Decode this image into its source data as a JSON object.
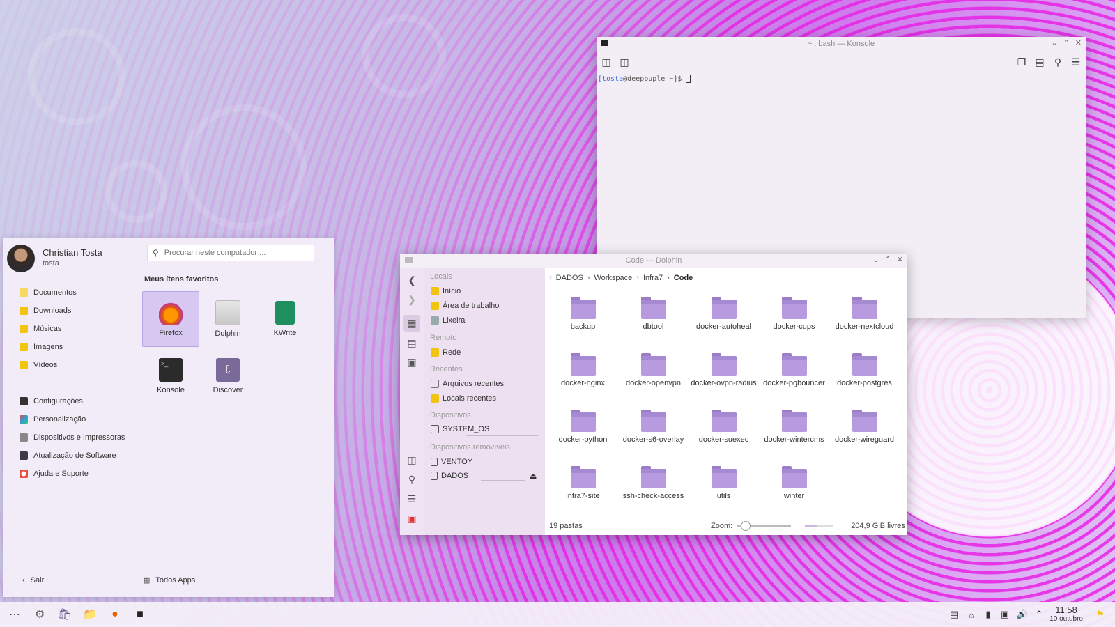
{
  "colors": {
    "accent": "#b89ae0",
    "folder": "#b89ae0",
    "selection": "#d6c8f0",
    "ribbon": "#e628e6"
  },
  "konsole": {
    "title": "~ : bash — Konsole",
    "prompt_user": "[tosta",
    "prompt_host": "@deeppuple ~]$",
    "toolbar_icons": [
      "new-tab-icon",
      "split-view-icon",
      "copy-icon",
      "paste-icon",
      "search-icon",
      "menu-icon"
    ]
  },
  "dolphin": {
    "title": "Code — Dolphin",
    "places": {
      "locais_head": "Locais",
      "inicio": "Início",
      "area": "Área de trabalho",
      "lixeira": "Lixeira",
      "remoto_head": "Remoto",
      "rede": "Rede",
      "recentes_head": "Recentes",
      "arquivos_recentes": "Arquivos recentes",
      "locais_recentes": "Locais recentes",
      "dispositivos_head": "Dispositivos",
      "system_os": "SYSTEM_OS",
      "removiveis_head": "Dispositivos removíveis",
      "ventoy": "VENTOY",
      "dados": "DADOS"
    },
    "breadcrumb": {
      "a": "DADOS",
      "b": "Workspace",
      "c": "Infra7",
      "current": "Code"
    },
    "folders": [
      "backup",
      "dbtool",
      "docker-autoheal",
      "docker-cups",
      "docker-nextcloud",
      "docker-nginx",
      "docker-openvpn",
      "docker-ovpn-radius",
      "docker-pgbouncer",
      "docker-postgres",
      "docker-python",
      "docker-s6-overlay",
      "docker-suexec",
      "docker-wintercms",
      "docker-wireguard",
      "infra7-site",
      "ssh-check-access",
      "utils",
      "winter"
    ],
    "status": {
      "count": "19 pastas",
      "zoom_label": "Zoom:",
      "free": "204,9 GiB livres",
      "zoom_fraction": 0.15
    }
  },
  "launcher": {
    "user_name": "Christian Tosta",
    "user_login": "tosta",
    "search_placeholder": "Procurar neste computador ...",
    "places": {
      "documentos": "Documentos",
      "downloads": "Downloads",
      "musicas": "Músicas",
      "imagens": "Imagens",
      "videos": "Vídeos"
    },
    "system": {
      "config": "Configurações",
      "personal": "Personalização",
      "devices": "Dispositivos e Impressoras",
      "update": "Atualização de Software",
      "help": "Ajuda e Suporte"
    },
    "favorites_title": "Meus ítens favoritos",
    "favorites": {
      "firefox": "Firefox",
      "dolphin": "Dolphin",
      "kwrite": "KWrite",
      "konsole": "Konsole",
      "discover": "Discover"
    },
    "footer": {
      "exit": "Sair",
      "all_apps": "Todos Apps"
    }
  },
  "taskbar": {
    "apps": [
      "app-grid-icon",
      "settings-icon",
      "discover-icon",
      "files-icon",
      "firefox-icon",
      "terminal-icon"
    ],
    "time": "11:58",
    "date": "10 outubro"
  }
}
